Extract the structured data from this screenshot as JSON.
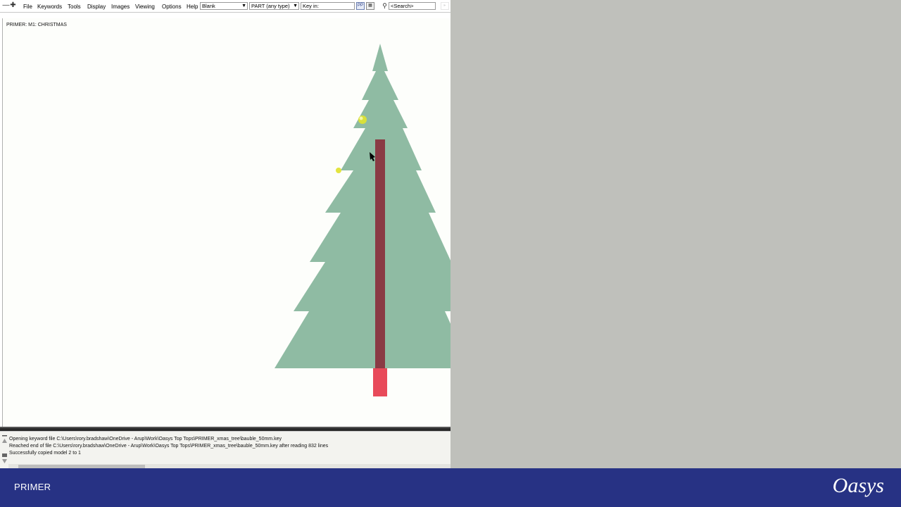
{
  "menubar": {
    "items": [
      "File",
      "Keywords",
      "Tools",
      "Display",
      "Images",
      "Viewing",
      "Options",
      "Help"
    ],
    "blank_select": "Blank",
    "part_select": "PART  (any type)",
    "key_in_placeholder": "Key in:",
    "search_placeholder": "<Search>",
    "pp_label": "PP"
  },
  "graphics": {
    "title": "PRIMER: M1: CHRISTMAS"
  },
  "colors": {
    "tree": "#8fbba3",
    "trunk": "#8a3a44",
    "base": "#e84a5a",
    "bauble": "#d8e03a",
    "footer": "#273284"
  },
  "console": {
    "messages": [
      "Opening keyword file C:\\Users\\rory.bradshaw\\OneDrive - Arup\\Work\\Oasys Top Tops\\PRIMER_xmas_tree\\bauble_50mm.key",
      "Reached end of file C:\\Users\\rory.bradshaw\\OneDrive - Arup\\Work\\Oasys Top Tops\\PRIMER_xmas_tree\\bauble_50mm.key after reading 832 lines",
      "Successfully copied model 2 to 1"
    ]
  },
  "footer": {
    "app_name": "PRIMER",
    "logo": "Oasys"
  }
}
